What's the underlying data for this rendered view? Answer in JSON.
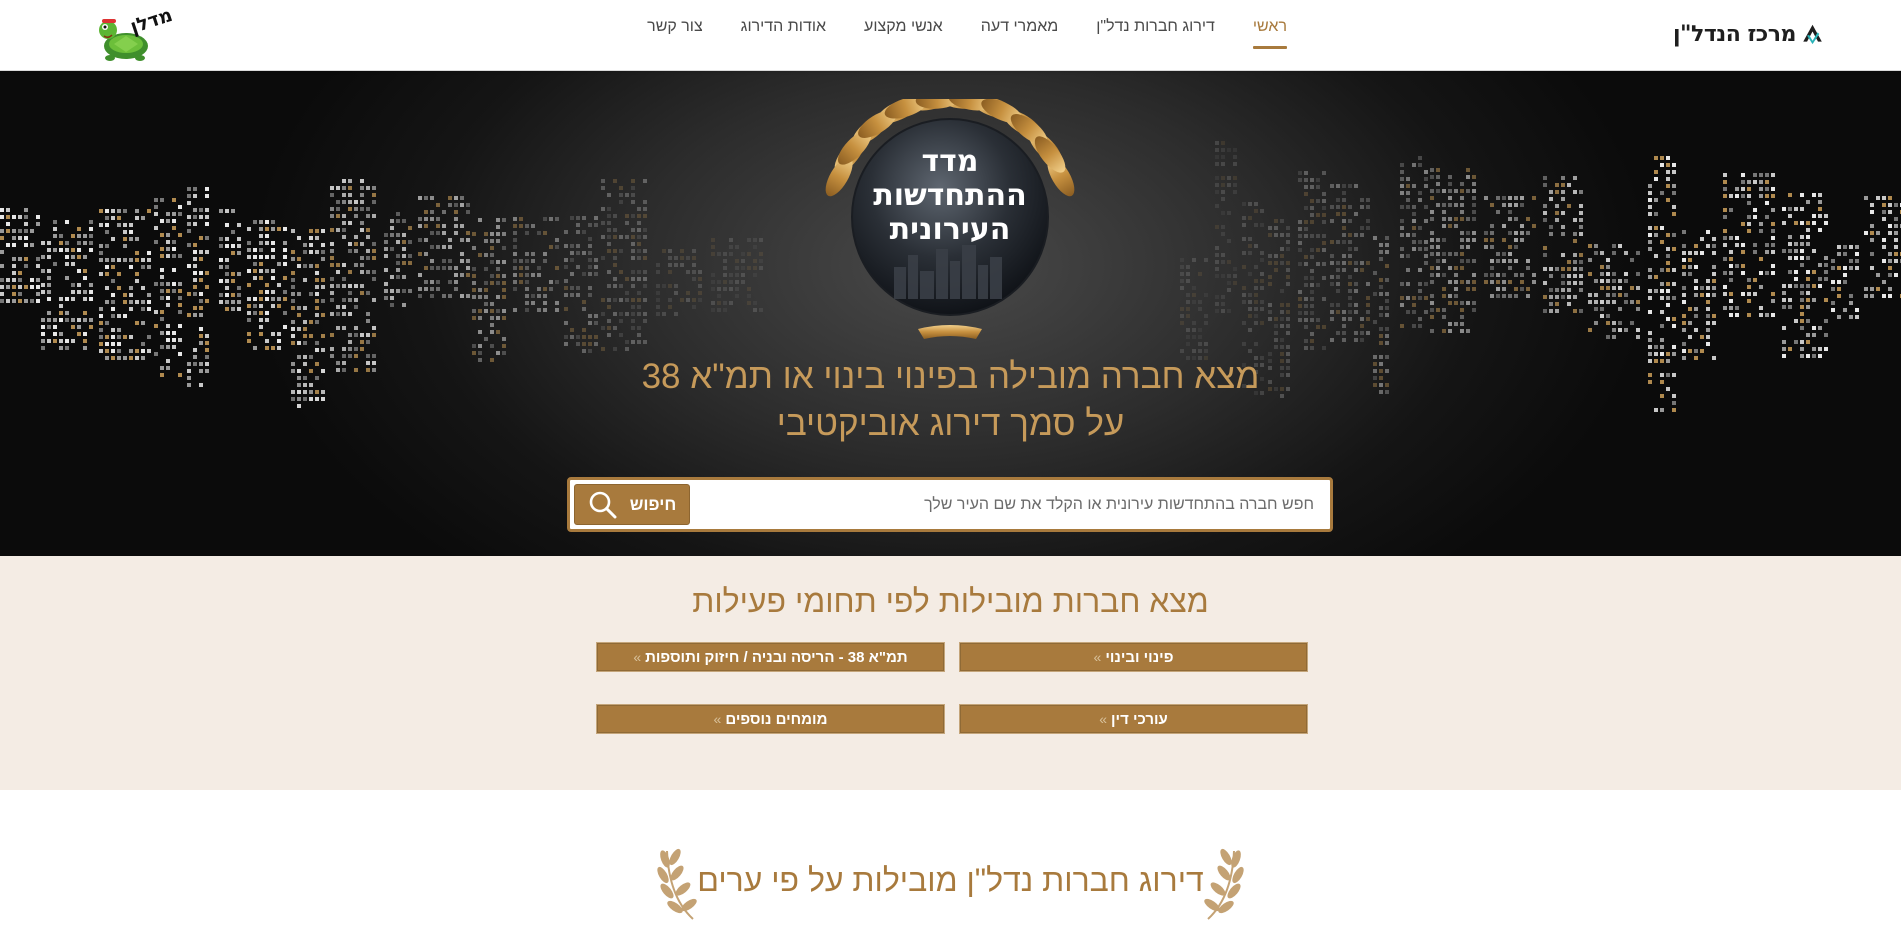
{
  "header": {
    "logo_text": "מרכז הנדל\"ן",
    "nav": [
      {
        "label": "ראשי",
        "active": true
      },
      {
        "label": "דירוג חברות נדל\"ן",
        "active": false
      },
      {
        "label": "מאמרי דעה",
        "active": false
      },
      {
        "label": "אנשי מקצוע",
        "active": false
      },
      {
        "label": "אודות הדירוג",
        "active": false
      },
      {
        "label": "צור קשר",
        "active": false
      }
    ],
    "partner_logo_text": "מדלן"
  },
  "hero": {
    "emblem_lines": [
      "מדד",
      "ההתחדשות",
      "העירונית"
    ],
    "title_line1": "מצא חברה מובילה בפינוי בינוי או תמ\"א 38",
    "title_line2": "על סמך דירוג אוביקטיבי",
    "search": {
      "placeholder": "חפש חברה בהתחדשות עירונית או הקלד את שם העיר שלך",
      "value": "",
      "button_label": "חיפוש",
      "button_icon": "search-icon"
    }
  },
  "categories": {
    "title": "מצא חברות מובילות לפי תחומי פעילות",
    "items": [
      {
        "label": "פינוי ובינוי"
      },
      {
        "label": "תמ\"א 38 - הריסה ובניה / חיזוק ותוספות"
      },
      {
        "label": "עורכי דין"
      },
      {
        "label": "מומחים נוספים"
      }
    ],
    "chevron": "»"
  },
  "ranking": {
    "title": "דירוג חברות נדל\"ן מובילות על פי ערים"
  },
  "colors": {
    "accent": "#a87a3d",
    "hero_title": "#c69a5a",
    "cats_bg": "#f4ece4"
  }
}
